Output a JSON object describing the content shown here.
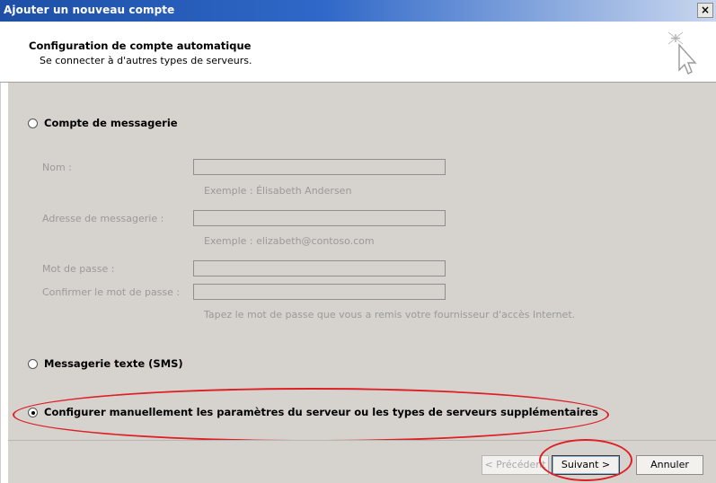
{
  "window": {
    "title": "Ajouter un nouveau compte",
    "close_label": "×"
  },
  "header": {
    "title": "Configuration de compte automatique",
    "subtitle": "Se connecter à d'autres types de serveurs.",
    "icon": "cursor-sparkle-icon"
  },
  "options": {
    "email_account": {
      "label": "Compte de messagerie",
      "selected": false
    },
    "sms": {
      "label": "Messagerie texte (SMS)",
      "selected": false
    },
    "manual": {
      "label": "Configurer manuellement les paramètres du serveur ou les types de serveurs supplémentaires",
      "selected": true
    }
  },
  "fields": {
    "name": {
      "label": "Nom :",
      "value": "",
      "hint": "Exemple : Élisabeth Andersen"
    },
    "email": {
      "label": "Adresse de messagerie :",
      "value": "",
      "hint": "Exemple : elizabeth@contoso.com"
    },
    "password": {
      "label": "Mot de passe :",
      "value": ""
    },
    "confirm_password": {
      "label": "Confirmer le mot de passe :",
      "value": "",
      "hint": "Tapez le mot de passe que vous a remis votre fournisseur d'accès Internet."
    }
  },
  "buttons": {
    "previous": "< Précédent",
    "next": "Suivant >",
    "cancel": "Annuler"
  },
  "annotation_color": "#dd1f26"
}
